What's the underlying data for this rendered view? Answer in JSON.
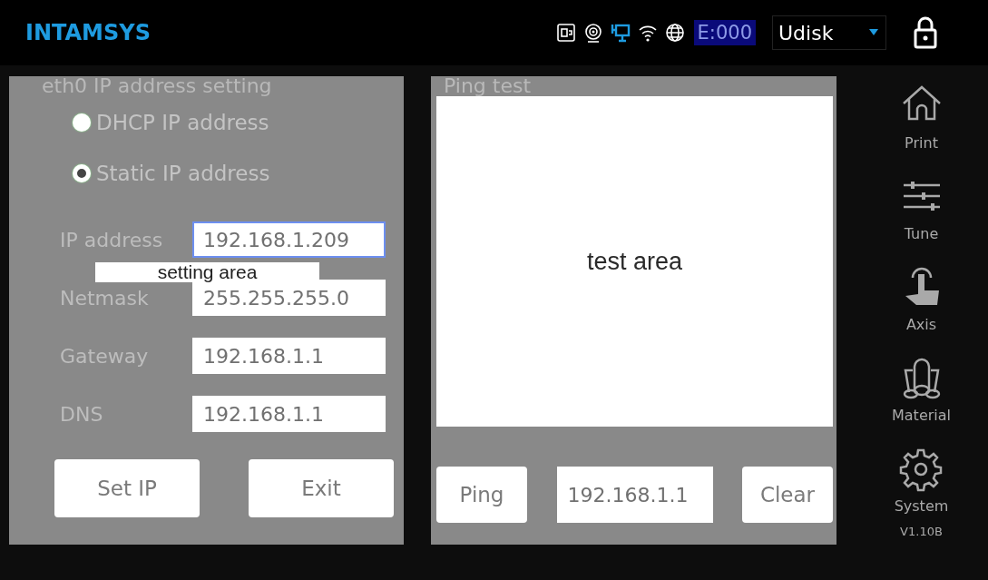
{
  "header": {
    "logo": "INTAMSYS",
    "error_code": "E:000",
    "storage": {
      "value": "Udisk"
    }
  },
  "ip_setting": {
    "title": "eth0 IP address setting",
    "modes": [
      {
        "label": "DHCP IP address",
        "selected": false
      },
      {
        "label": "Static IP address",
        "selected": true
      }
    ],
    "fields": [
      {
        "label": "IP address",
        "value": "192.168.1.209",
        "focused": true
      },
      {
        "label": "Netmask",
        "value": "255.255.255.0",
        "focused": false
      },
      {
        "label": "Gateway",
        "value": "192.168.1.1",
        "focused": false
      },
      {
        "label": "DNS",
        "value": "192.168.1.1",
        "focused": false
      }
    ],
    "buttons": [
      "Set IP",
      "Exit"
    ],
    "annotation": "setting area"
  },
  "ping_test": {
    "title": "Ping test",
    "annotation": "test area",
    "buttons": [
      "Ping",
      "Clear"
    ],
    "address": "192.168.1.1"
  },
  "sidebar": {
    "items": [
      {
        "label": "Print",
        "kind": "home"
      },
      {
        "label": "Tune",
        "kind": "sliders"
      },
      {
        "label": "Axis",
        "kind": "hand"
      },
      {
        "label": "Material",
        "kind": "spools"
      },
      {
        "label": "System",
        "kind": "gear"
      }
    ],
    "version": "V1.10B"
  }
}
